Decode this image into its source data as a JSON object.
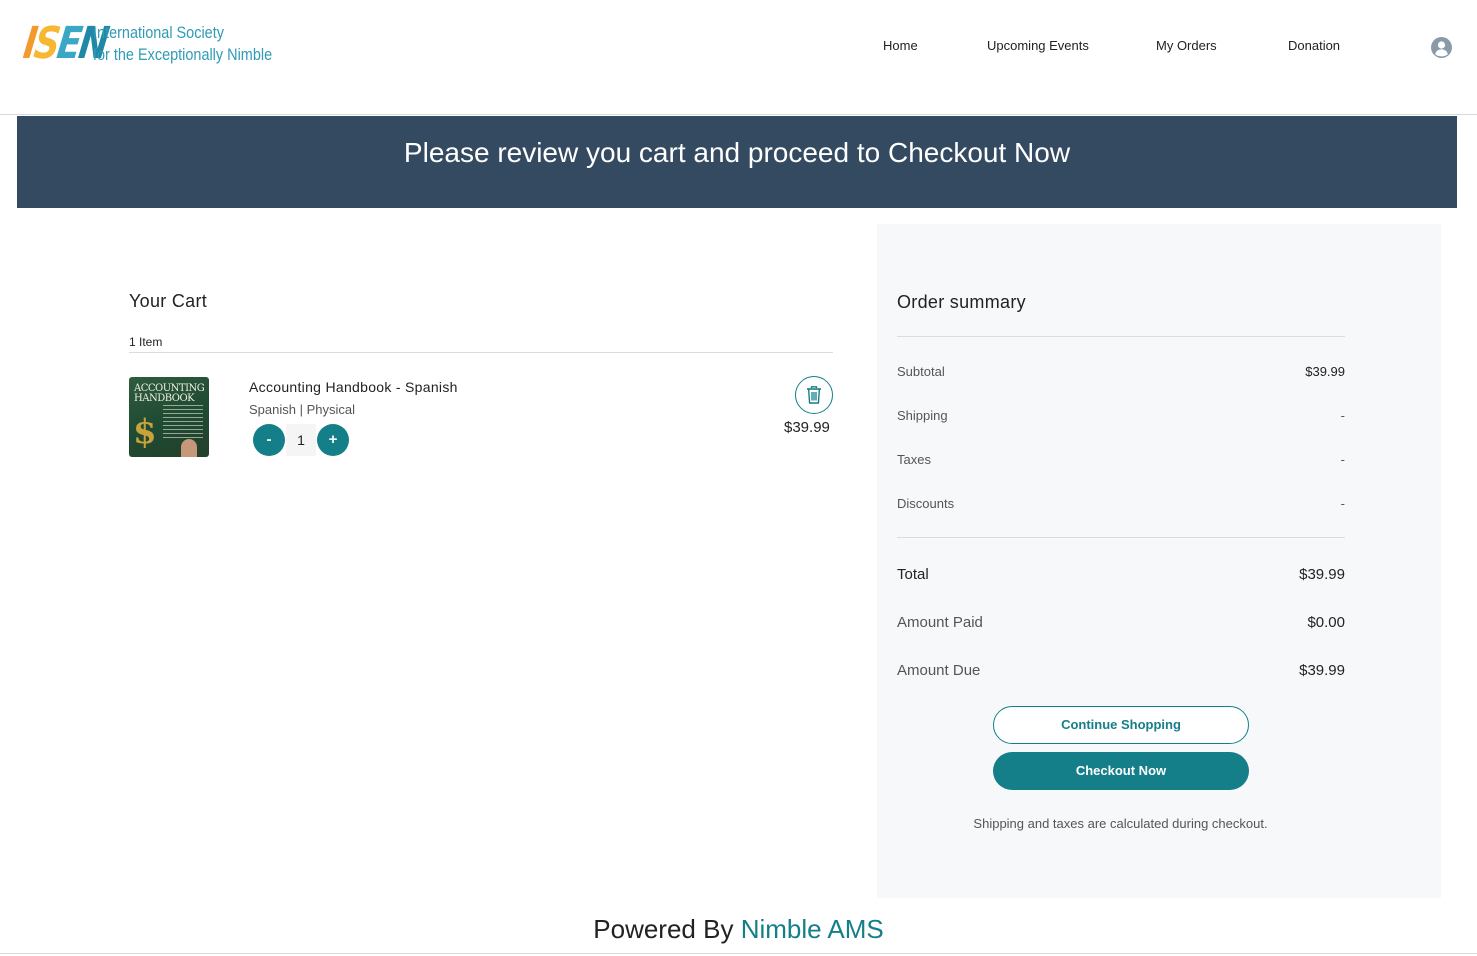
{
  "header": {
    "logo_mark": [
      "I",
      "S",
      "E",
      "N"
    ],
    "logo_line1": "International Society",
    "logo_line2": "for the Exceptionally Nimble",
    "nav": {
      "home": "Home",
      "upcoming_events": "Upcoming Events",
      "my_orders": "My Orders",
      "donation": "Donation"
    },
    "user_icon": "user-circle-icon"
  },
  "banner": {
    "text": "Please review you cart and proceed to Checkout Now"
  },
  "cart": {
    "title": "Your Cart",
    "item_count": "1 Item",
    "items": [
      {
        "image_title": "ACCOUNTING HANDBOOK",
        "name": "Accounting Handbook - Spanish",
        "variant": "Spanish | Physical",
        "minus_label": "-",
        "quantity": "1",
        "plus_label": "+",
        "price": "$39.99",
        "delete_icon": "trash-icon"
      }
    ]
  },
  "summary": {
    "title": "Order summary",
    "subtotal_label": "Subtotal",
    "subtotal_value": "$39.99",
    "shipping_label": "Shipping",
    "shipping_value": "-",
    "taxes_label": "Taxes",
    "taxes_value": "-",
    "discounts_label": "Discounts",
    "discounts_value": "-",
    "total_label": "Total",
    "total_value": "$39.99",
    "amount_paid_label": "Amount Paid",
    "amount_paid_value": "$0.00",
    "amount_due_label": "Amount Due",
    "amount_due_value": "$39.99",
    "continue_label": "Continue Shopping",
    "checkout_label": "Checkout Now",
    "note": "Shipping and taxes are calculated during checkout."
  },
  "footer": {
    "prefix": "Powered By",
    "brand": "Nimble AMS"
  },
  "colors": {
    "banner": "#344a60",
    "accent": "#157f89",
    "summary_bg": "#f7f8f9",
    "logo_orange": "#f39a2b",
    "logo_blue": "#2f9bb5"
  }
}
